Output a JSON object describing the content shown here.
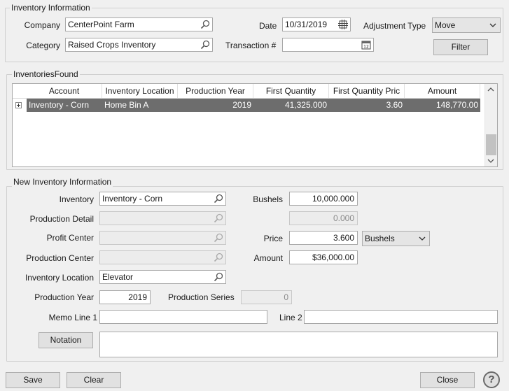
{
  "inventory_information": {
    "title": "Inventory Information",
    "company_label": "Company",
    "company_value": "CenterPoint Farm",
    "category_label": "Category",
    "category_value": "Raised Crops Inventory",
    "date_label": "Date",
    "date_value": "10/31/2019",
    "transaction_label": "Transaction #",
    "transaction_value": "",
    "adjustment_type_label": "Adjustment Type",
    "adjustment_type_value": "Move",
    "filter_button": "Filter"
  },
  "inventories_found": {
    "title": "InventoriesFound",
    "columns": [
      "Account",
      "Inventory Location",
      "Production Year",
      "First Quantity",
      "First Quantity Pric",
      "Amount"
    ],
    "rows": [
      {
        "expander": "+",
        "account": "Inventory -  Corn",
        "inventory_location": "Home Bin A",
        "production_year": "2019",
        "first_quantity": "41,325.000",
        "first_quantity_price": "3.60",
        "amount": "148,770.00"
      }
    ]
  },
  "new_inventory_information": {
    "title": "New Inventory Information",
    "inventory_label": "Inventory",
    "inventory_value": "Inventory -  Corn",
    "production_detail_label": "Production Detail",
    "production_detail_value": "",
    "profit_center_label": "Profit Center",
    "profit_center_value": "",
    "production_center_label": "Production Center",
    "production_center_value": "",
    "inventory_location_label": "Inventory Location",
    "inventory_location_value": "Elevator",
    "production_year_label": "Production Year",
    "production_year_value": "2019",
    "production_series_label": "Production Series",
    "production_series_value": "0",
    "bushels_label": "Bushels",
    "bushels_value": "10,000.000",
    "secondary_qty_value": "0.000",
    "price_label": "Price",
    "price_value": "3.600",
    "price_unit_value": "Bushels",
    "amount_label": "Amount",
    "amount_value": "$36,000.00",
    "memo1_label": "Memo Line 1",
    "memo1_value": "",
    "line2_label": "Line 2",
    "line2_value": "",
    "notation_button": "Notation",
    "notation_value": ""
  },
  "footer": {
    "save_button": "Save",
    "clear_button": "Clear",
    "close_button": "Close",
    "help_icon": "?"
  },
  "icons": {
    "search": "magnifier-icon",
    "calendar": "calendar-icon",
    "dropdown": "chevron-down-icon"
  }
}
